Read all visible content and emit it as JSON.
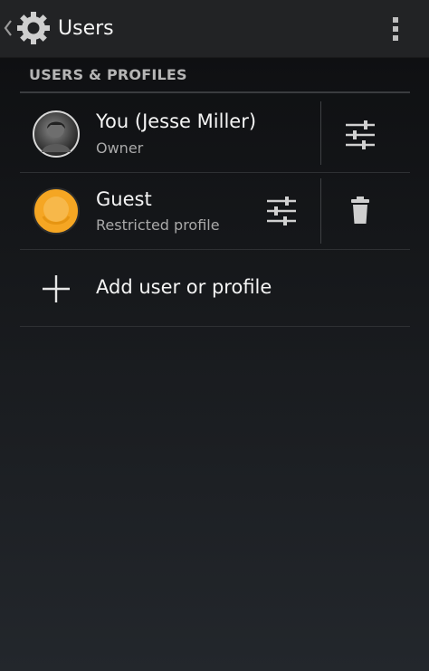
{
  "action_bar": {
    "title": "Users"
  },
  "section": {
    "header": "USERS & PROFILES"
  },
  "users": [
    {
      "name": "You (Jesse Miller)",
      "subtitle": "Owner"
    },
    {
      "name": "Guest",
      "subtitle": "Restricted profile"
    }
  ],
  "add_item": {
    "label": "Add user or profile"
  },
  "colors": {
    "guest_avatar": "#f5a623",
    "header_text": "#b5b5b5"
  },
  "icons": [
    "back-chevron-icon",
    "settings-gear-icon",
    "overflow-menu-icon",
    "sliders-icon",
    "trash-icon",
    "plus-icon"
  ]
}
